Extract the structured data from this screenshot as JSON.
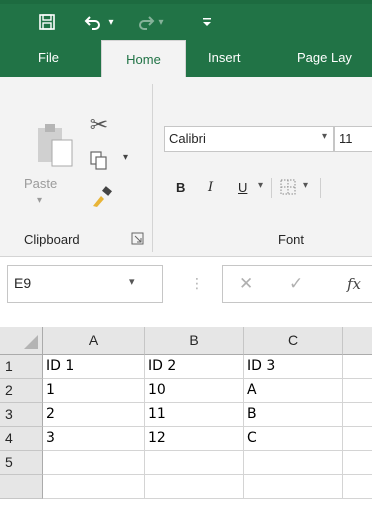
{
  "quick_access": {
    "save_icon": "save-icon",
    "undo_icon": "undo-icon",
    "redo_icon": "redo-icon",
    "customize_icon": "customize-qat-icon"
  },
  "tabs": [
    {
      "label": "File",
      "active": false
    },
    {
      "label": "Home",
      "active": true
    },
    {
      "label": "Insert",
      "active": false
    },
    {
      "label": "Page Lay",
      "active": false
    }
  ],
  "clipboard": {
    "paste_label": "Paste",
    "group_label": "Clipboard",
    "cut_icon": "scissors-icon",
    "copy_icon": "copy-icon",
    "format_painter_icon": "format-painter-icon"
  },
  "font": {
    "name": "Calibri",
    "size": "11",
    "bold": "B",
    "italic": "I",
    "underline": "U",
    "group_label": "Font"
  },
  "formula_bar": {
    "name_box": "E9",
    "cancel_glyph": "✕",
    "enter_glyph": "✓",
    "fx_label": "fx"
  },
  "sheet": {
    "columns": [
      "A",
      "B",
      "C"
    ],
    "rows": [
      {
        "num": "1",
        "cells": [
          "ID 1",
          "ID 2",
          "ID 3"
        ]
      },
      {
        "num": "2",
        "cells": [
          "1",
          "10",
          "A"
        ]
      },
      {
        "num": "3",
        "cells": [
          "2",
          "11",
          "B"
        ]
      },
      {
        "num": "4",
        "cells": [
          "3",
          "12",
          "C"
        ]
      },
      {
        "num": "5",
        "cells": [
          "",
          "",
          ""
        ]
      },
      {
        "num": "",
        "cells": [
          "",
          "",
          ""
        ]
      }
    ]
  },
  "colors": {
    "accent": "#217346",
    "ribbon_bg": "#f3f3f3",
    "header_bg": "#e6e6e6"
  }
}
